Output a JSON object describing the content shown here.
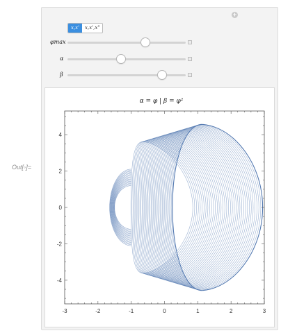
{
  "output_label": "Out[◦]=",
  "toggle": {
    "options": [
      "x,x'",
      "x,x',x\""
    ],
    "selected": 0
  },
  "controls": [
    {
      "label": "φmax",
      "value": 0.66
    },
    {
      "label": "α",
      "value": 0.45
    },
    {
      "label": "β",
      "value": 0.8
    }
  ],
  "plot": {
    "title": "α = φ    |    β = φ²",
    "x_ticks": [
      "-3",
      "-2",
      "-1",
      "0",
      "1",
      "2",
      "3"
    ],
    "y_ticks": [
      "4",
      "2",
      "0",
      "-2",
      "-4"
    ]
  },
  "chart_data": {
    "type": "line",
    "title": "α = φ    |    β = φ²",
    "xlim": [
      -3,
      3
    ],
    "ylim": [
      -5.3,
      5.3
    ],
    "series_color": "#4a72ad",
    "curve": "nested closed orbits, left edge near x=-1.5, right edge near x=2.9, top near y=4.6, bottom near y=-4.5",
    "grid": false
  }
}
